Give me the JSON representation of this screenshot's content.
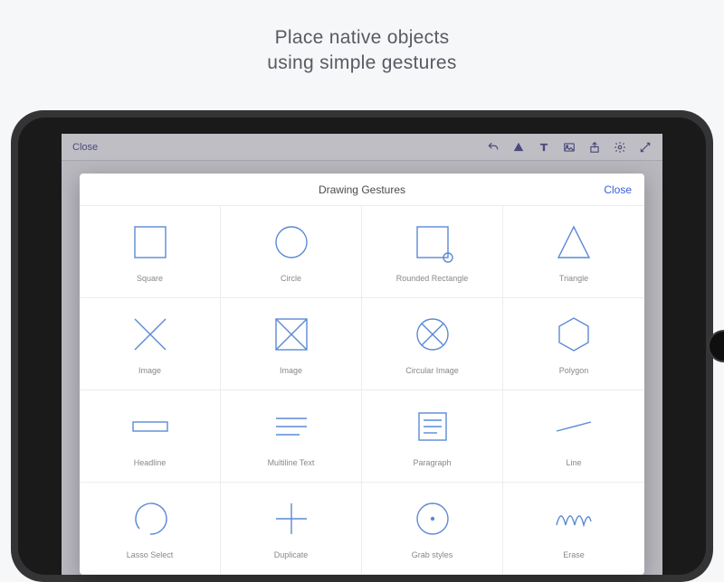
{
  "headline_line1": "Place native objects",
  "headline_line2": "using simple gestures",
  "toolbar": {
    "close_label": "Close"
  },
  "modal": {
    "title": "Drawing Gestures",
    "close_label": "Close"
  },
  "gestures": [
    {
      "name": "square",
      "label": "Square"
    },
    {
      "name": "circle",
      "label": "Circle"
    },
    {
      "name": "rounded-rectangle",
      "label": "Rounded Rectangle"
    },
    {
      "name": "triangle",
      "label": "Triangle"
    },
    {
      "name": "image-x",
      "label": "Image"
    },
    {
      "name": "image-box-x",
      "label": "Image"
    },
    {
      "name": "circular-image",
      "label": "Circular Image"
    },
    {
      "name": "polygon",
      "label": "Polygon"
    },
    {
      "name": "headline",
      "label": "Headline"
    },
    {
      "name": "multiline-text",
      "label": "Multiline Text"
    },
    {
      "name": "paragraph",
      "label": "Paragraph"
    },
    {
      "name": "line",
      "label": "Line"
    },
    {
      "name": "lasso-select",
      "label": "Lasso Select"
    },
    {
      "name": "duplicate",
      "label": "Duplicate"
    },
    {
      "name": "grab-styles",
      "label": "Grab styles"
    },
    {
      "name": "erase",
      "label": "Erase"
    }
  ]
}
